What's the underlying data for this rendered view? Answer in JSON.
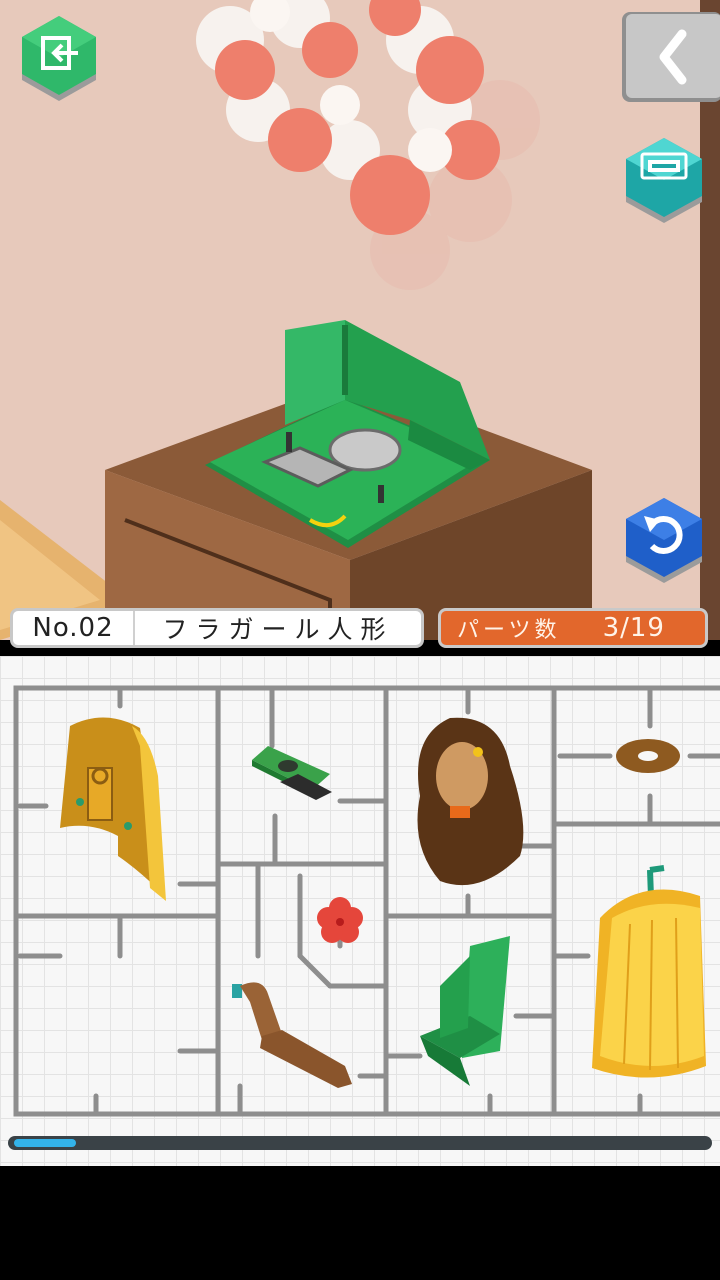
{
  "header": {
    "number": "No.02",
    "name": "フラガール人形",
    "parts_label": "パーツ数",
    "parts_count": "3/19"
  },
  "progress": {
    "fraction": 0.09
  },
  "colors": {
    "accent_green": "#2fb86a",
    "accent_orange": "#e2672c",
    "accent_blue": "#2a6bd0",
    "accent_teal": "#35c7c5",
    "progress_fill": "#33b3ea"
  },
  "icons": {
    "exit": "exit-icon",
    "back": "chevron-left-icon",
    "hint": "hint-icon",
    "rotate": "rotate-icon"
  },
  "parts": [
    "shell-part",
    "circuit-board-part",
    "hair-part",
    "ring-part",
    "hibiscus-flower-part",
    "arm-part",
    "green-frame-part",
    "skirt-part"
  ]
}
